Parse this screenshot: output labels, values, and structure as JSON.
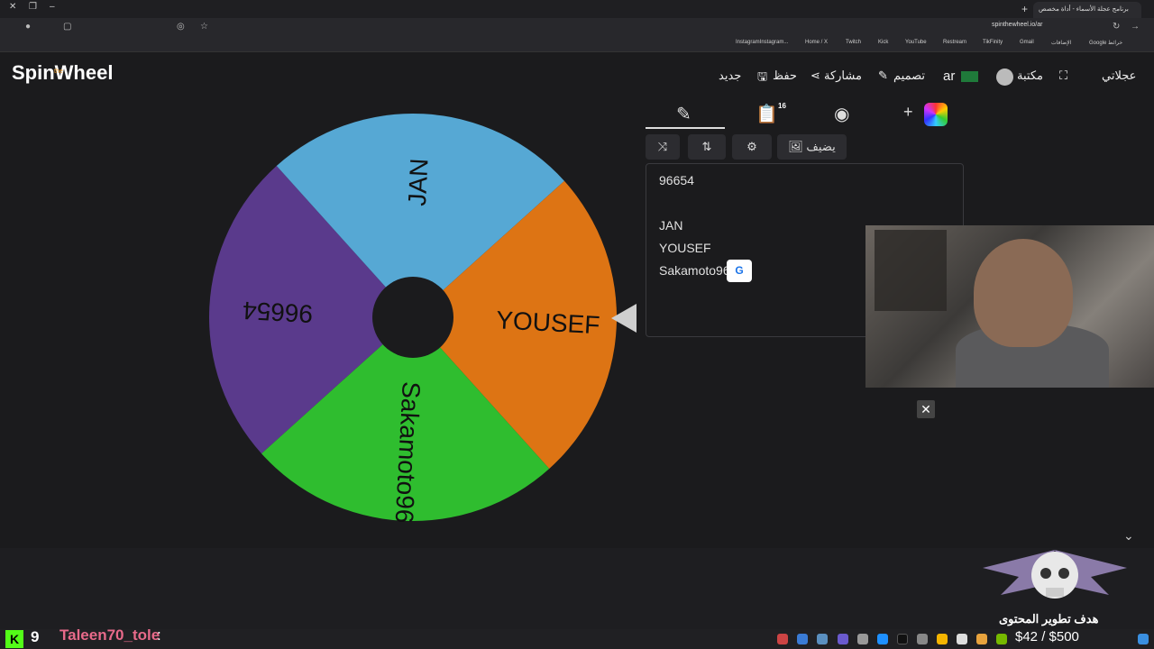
{
  "browser": {
    "tab_title": "برنامج عجلة الأسماء - أداة مخصص",
    "address": "spinthewheel.io/ar",
    "bookmarks": [
      "InstagramInstagram...",
      "Home / X",
      "Twitch",
      "Kick",
      "YouTube",
      "Restream",
      "TikFinity",
      "Gmail",
      "الإضافات",
      "Google خرائط"
    ]
  },
  "header": {
    "logo": "SpinWheel",
    "logo_small": "the",
    "nav": {
      "new": "جديد",
      "save": "حفظ",
      "share": "مشاركة",
      "design": "تصميم",
      "lang": "ar",
      "library": "مكتبة",
      "wheels": "عجلاتي"
    }
  },
  "wheel": {
    "segments": [
      {
        "label": "96654",
        "color": "#5a3a8c"
      },
      {
        "label": "JAN",
        "color": "#56a8d4"
      },
      {
        "label": "YOUSEF",
        "color": "#dd7414"
      },
      {
        "label": "Sakamoto96",
        "color": "#2fbd2f"
      }
    ]
  },
  "panel": {
    "entries_count": "16",
    "add_image_label": "يضيف",
    "entries": [
      "96654",
      "",
      "JAN",
      "YOUSEF",
      "Sakamoto96"
    ]
  },
  "stream": {
    "viewers": "9",
    "chat_user": "Taleen70_tole",
    "chat_sep": ":",
    "goal_label": "هدف تطوير المحتوى",
    "goal_amount": "$42 / $500"
  }
}
